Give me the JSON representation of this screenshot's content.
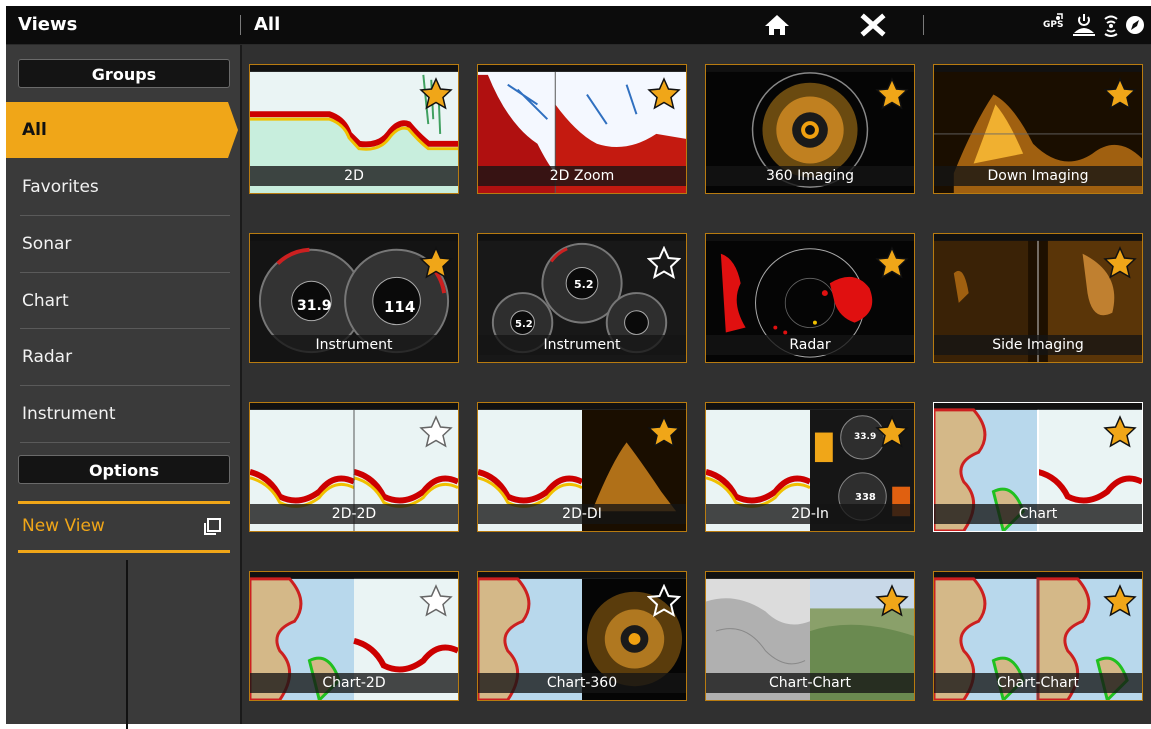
{
  "topbar": {
    "views_title": "Views",
    "group_title": "All",
    "home_icon": "home-icon",
    "close_icon": "close-x-icon",
    "gps_label": "GPS"
  },
  "sidebar": {
    "groups_header": "Groups",
    "groups": [
      {
        "label": "All",
        "selected": true
      },
      {
        "label": "Favorites",
        "selected": false
      },
      {
        "label": "Sonar",
        "selected": false
      },
      {
        "label": "Chart",
        "selected": false
      },
      {
        "label": "Radar",
        "selected": false
      },
      {
        "label": "Instrument",
        "selected": false
      }
    ],
    "options_header": "Options",
    "new_view_label": "New View"
  },
  "views": [
    {
      "label": "2D",
      "favorite": true
    },
    {
      "label": "2D Zoom",
      "favorite": true
    },
    {
      "label": "360 Imaging",
      "favorite": true
    },
    {
      "label": "Down Imaging",
      "favorite": true
    },
    {
      "label": "Instrument",
      "favorite": true
    },
    {
      "label": "Instrument",
      "favorite": false
    },
    {
      "label": "Radar",
      "favorite": true
    },
    {
      "label": "Side Imaging",
      "favorite": true
    },
    {
      "label": "2D-2D",
      "favorite": false
    },
    {
      "label": "2D-DI",
      "favorite": true
    },
    {
      "label": "2D-In",
      "favorite": true
    },
    {
      "label": "Chart",
      "favorite": true
    },
    {
      "label": "Chart-2D",
      "favorite": false
    },
    {
      "label": "Chart-360",
      "favorite": false
    },
    {
      "label": "Chart-Chart",
      "favorite": true
    },
    {
      "label": "Chart-Chart",
      "favorite": true
    }
  ],
  "instrument_readouts": {
    "gauge_a": "31.9",
    "gauge_b": "114",
    "gauge_c": "5.2",
    "gauge_d": "5.2",
    "gauge_e": "33.9",
    "gauge_f": "338"
  },
  "colors": {
    "accent": "#f0a618",
    "background": "#303030",
    "topbar": "#0c0c0c"
  }
}
